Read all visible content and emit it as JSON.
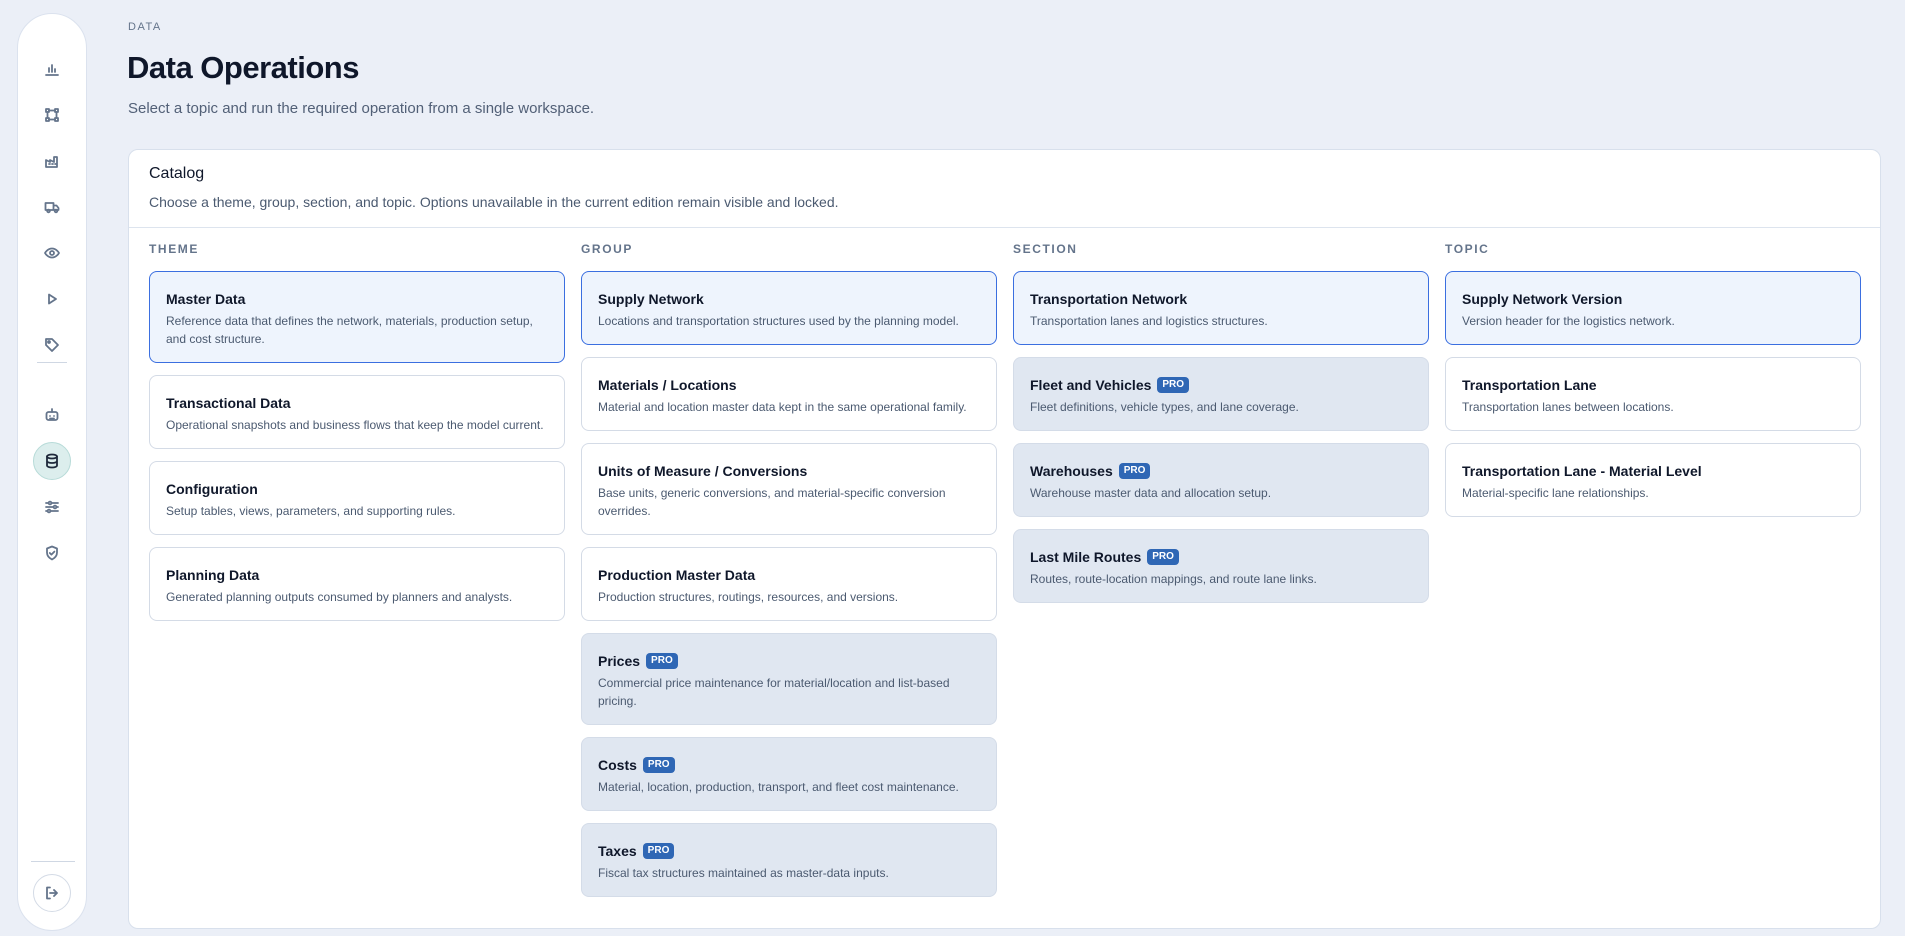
{
  "sidebar": {
    "items": [
      {
        "icon": "bar-chart-icon"
      },
      {
        "icon": "network-icon"
      },
      {
        "icon": "factory-icon"
      },
      {
        "icon": "truck-icon"
      },
      {
        "icon": "eye-icon"
      },
      {
        "icon": "play-icon"
      },
      {
        "icon": "tag-icon"
      },
      {
        "icon": "robot-icon"
      },
      {
        "icon": "database-icon",
        "active": true
      },
      {
        "icon": "sliders-icon"
      },
      {
        "icon": "shield-check-icon"
      }
    ],
    "logout_icon": "logout-icon"
  },
  "header": {
    "eyebrow": "DATA",
    "title": "Data Operations",
    "subtitle": "Select a topic and run the required operation from a single workspace."
  },
  "catalog": {
    "title": "Catalog",
    "description": "Choose a theme, group, section, and topic. Options unavailable in the current edition remain visible and locked.",
    "badge_label": "PRO",
    "columns": {
      "theme": {
        "label": "THEME",
        "items": [
          {
            "title": "Master Data",
            "desc": "Reference data that defines the network, materials, production setup, and cost structure.",
            "selected": true
          },
          {
            "title": "Transactional Data",
            "desc": "Operational snapshots and business flows that keep the model current."
          },
          {
            "title": "Configuration",
            "desc": "Setup tables, views, parameters, and supporting rules."
          },
          {
            "title": "Planning Data",
            "desc": "Generated planning outputs consumed by planners and analysts."
          }
        ]
      },
      "group": {
        "label": "GROUP",
        "items": [
          {
            "title": "Supply Network",
            "desc": "Locations and transportation structures used by the planning model.",
            "selected": true
          },
          {
            "title": "Materials / Locations",
            "desc": "Material and location master data kept in the same operational family."
          },
          {
            "title": "Units of Measure / Conversions",
            "desc": "Base units, generic conversions, and material-specific conversion overrides."
          },
          {
            "title": "Production Master Data",
            "desc": "Production structures, routings, resources, and versions."
          },
          {
            "title": "Prices",
            "desc": "Commercial price maintenance for material/location and list-based pricing.",
            "pro": true
          },
          {
            "title": "Costs",
            "desc": "Material, location, production, transport, and fleet cost maintenance.",
            "pro": true
          },
          {
            "title": "Taxes",
            "desc": "Fiscal tax structures maintained as master-data inputs.",
            "pro": true
          }
        ]
      },
      "section": {
        "label": "SECTION",
        "items": [
          {
            "title": "Transportation Network",
            "desc": "Transportation lanes and logistics structures.",
            "selected": true
          },
          {
            "title": "Fleet and Vehicles",
            "desc": "Fleet definitions, vehicle types, and lane coverage.",
            "pro": true
          },
          {
            "title": "Warehouses",
            "desc": "Warehouse master data and allocation setup.",
            "pro": true
          },
          {
            "title": "Last Mile Routes",
            "desc": "Routes, route-location mappings, and route lane links.",
            "pro": true
          }
        ]
      },
      "topic": {
        "label": "TOPIC",
        "items": [
          {
            "title": "Supply Network Version",
            "desc": "Version header for the logistics network.",
            "selected": true
          },
          {
            "title": "Transportation Lane",
            "desc": "Transportation lanes between locations."
          },
          {
            "title": "Transportation Lane - Material Level",
            "desc": "Material-specific lane relationships."
          }
        ]
      }
    }
  }
}
